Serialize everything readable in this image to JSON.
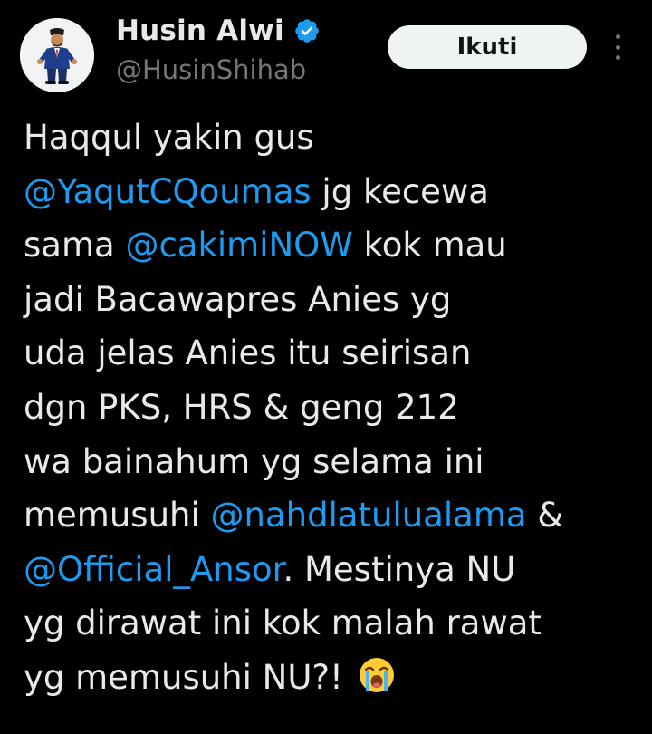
{
  "author": {
    "display_name": "Husin Alwi",
    "handle": "@HusinShihab",
    "verified": true,
    "avatar": "profile-photo"
  },
  "actions": {
    "follow_label": "Ikuti",
    "more_icon": "more-vertical-icon"
  },
  "tweet": {
    "lines": [
      [
        "Haqqul yakin gus"
      ],
      [
        "@YaqutCQoumas",
        " jg kecewa"
      ],
      [
        "sama ",
        "@cakimiNOW",
        " kok mau"
      ],
      [
        "jadi Bacawapres Anies yg"
      ],
      [
        "uda jelas Anies itu seirisan"
      ],
      [
        "dgn PKS, HRS & geng 212"
      ],
      [
        "wa bainahum yg selama ini"
      ],
      [
        "memusuhi ",
        "@nahdlatulualama",
        " &"
      ],
      [
        "@Official_Ansor",
        ". Mestinya NU"
      ],
      [
        "yg dirawat ini kok malah rawat"
      ],
      [
        "yg memusuhi NU?!"
      ]
    ],
    "emoji": "loudly-crying-face-icon"
  },
  "colors": {
    "background": "#000000",
    "text": "#e7e9ea",
    "mention": "#1d9bf0",
    "secondary": "#71767b",
    "verified_badge": "#1d9bf0",
    "button_bg": "#eff3f4"
  }
}
